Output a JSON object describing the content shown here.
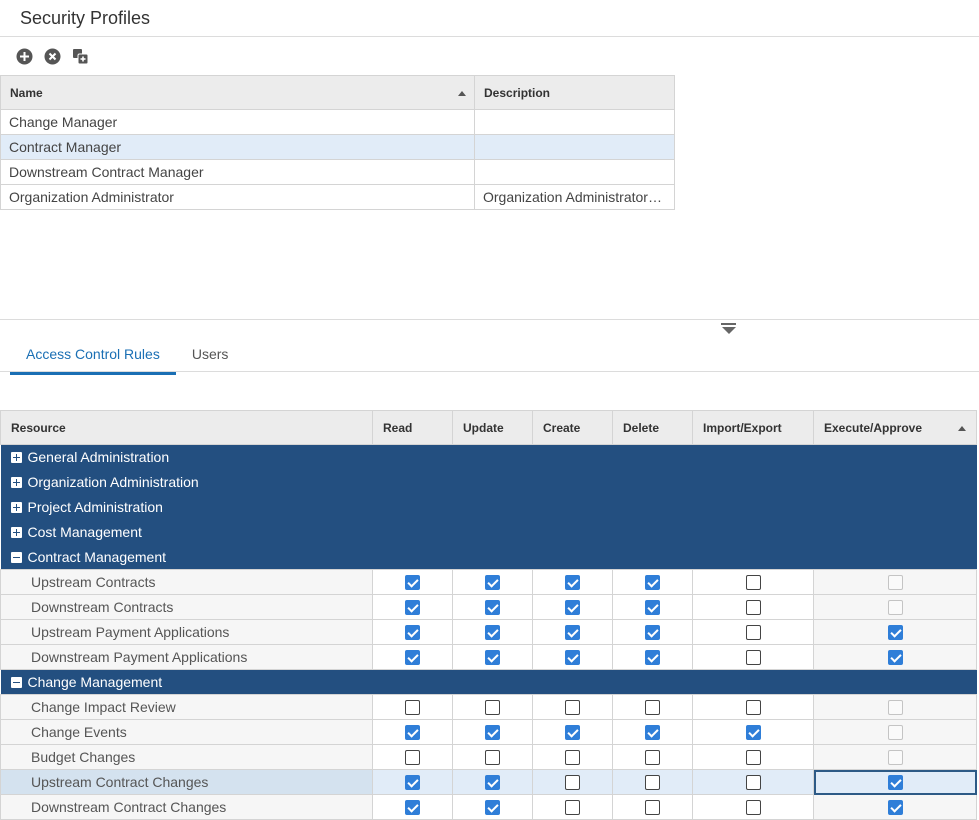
{
  "page": {
    "title": "Security Profiles"
  },
  "toolbar": {
    "add_icon": "add-circle-icon",
    "remove_icon": "remove-circle-icon",
    "copy_icon": "copy-add-icon"
  },
  "profiles": {
    "columns": {
      "name": "Name",
      "description": "Description"
    },
    "rows": [
      {
        "name": "Change Manager",
        "description": ""
      },
      {
        "name": "Contract Manager",
        "description": ""
      },
      {
        "name": "Downstream Contract Manager",
        "description": ""
      },
      {
        "name": "Organization Administrator",
        "description": "Organization Administrator…"
      }
    ],
    "selected": "Contract Manager"
  },
  "tabs": [
    {
      "label": "Access Control Rules",
      "active": true
    },
    {
      "label": "Users",
      "active": false
    }
  ],
  "rules": {
    "columns": {
      "resource": "Resource",
      "read": "Read",
      "update": "Update",
      "create": "Create",
      "delete": "Delete",
      "import_export": "Import/Export",
      "execute_approve": "Execute/Approve"
    },
    "groups": [
      {
        "label": "General Administration",
        "expanded": false
      },
      {
        "label": "Organization Administration",
        "expanded": false
      },
      {
        "label": "Project Administration",
        "expanded": false
      },
      {
        "label": "Cost Management",
        "expanded": false
      },
      {
        "label": "Contract Management",
        "expanded": true
      },
      {
        "label": "Upstream Contracts",
        "perms": [
          true,
          true,
          true,
          true,
          false,
          false
        ],
        "exec_disabled": true
      },
      {
        "label": "Downstream Contracts",
        "perms": [
          true,
          true,
          true,
          true,
          false,
          false
        ],
        "exec_disabled": true
      },
      {
        "label": "Upstream Payment Applications",
        "perms": [
          true,
          true,
          true,
          true,
          false,
          true
        ],
        "exec_disabled": false
      },
      {
        "label": "Downstream Payment Applications",
        "perms": [
          true,
          true,
          true,
          true,
          false,
          true
        ],
        "exec_disabled": false
      },
      {
        "label": "Change Management",
        "expanded": true
      },
      {
        "label": "Change Impact Review",
        "perms": [
          false,
          false,
          false,
          false,
          false,
          false
        ],
        "exec_disabled": true
      },
      {
        "label": "Change Events",
        "perms": [
          true,
          true,
          true,
          true,
          true,
          false
        ],
        "exec_disabled": true
      },
      {
        "label": "Budget Changes",
        "perms": [
          false,
          false,
          false,
          false,
          false,
          false
        ],
        "exec_disabled": true
      },
      {
        "label": "Upstream Contract Changes",
        "perms": [
          true,
          true,
          false,
          false,
          false,
          true
        ],
        "exec_disabled": false,
        "highlighted": true
      },
      {
        "label": "Downstream Contract Changes",
        "perms": [
          true,
          true,
          false,
          false,
          false,
          true
        ],
        "exec_disabled": false
      }
    ]
  },
  "colors": {
    "accent": "#1a6fb4",
    "group_header": "#234f80",
    "checkbox_on": "#2f7ed8",
    "selected_row": "#e1ecf8"
  }
}
